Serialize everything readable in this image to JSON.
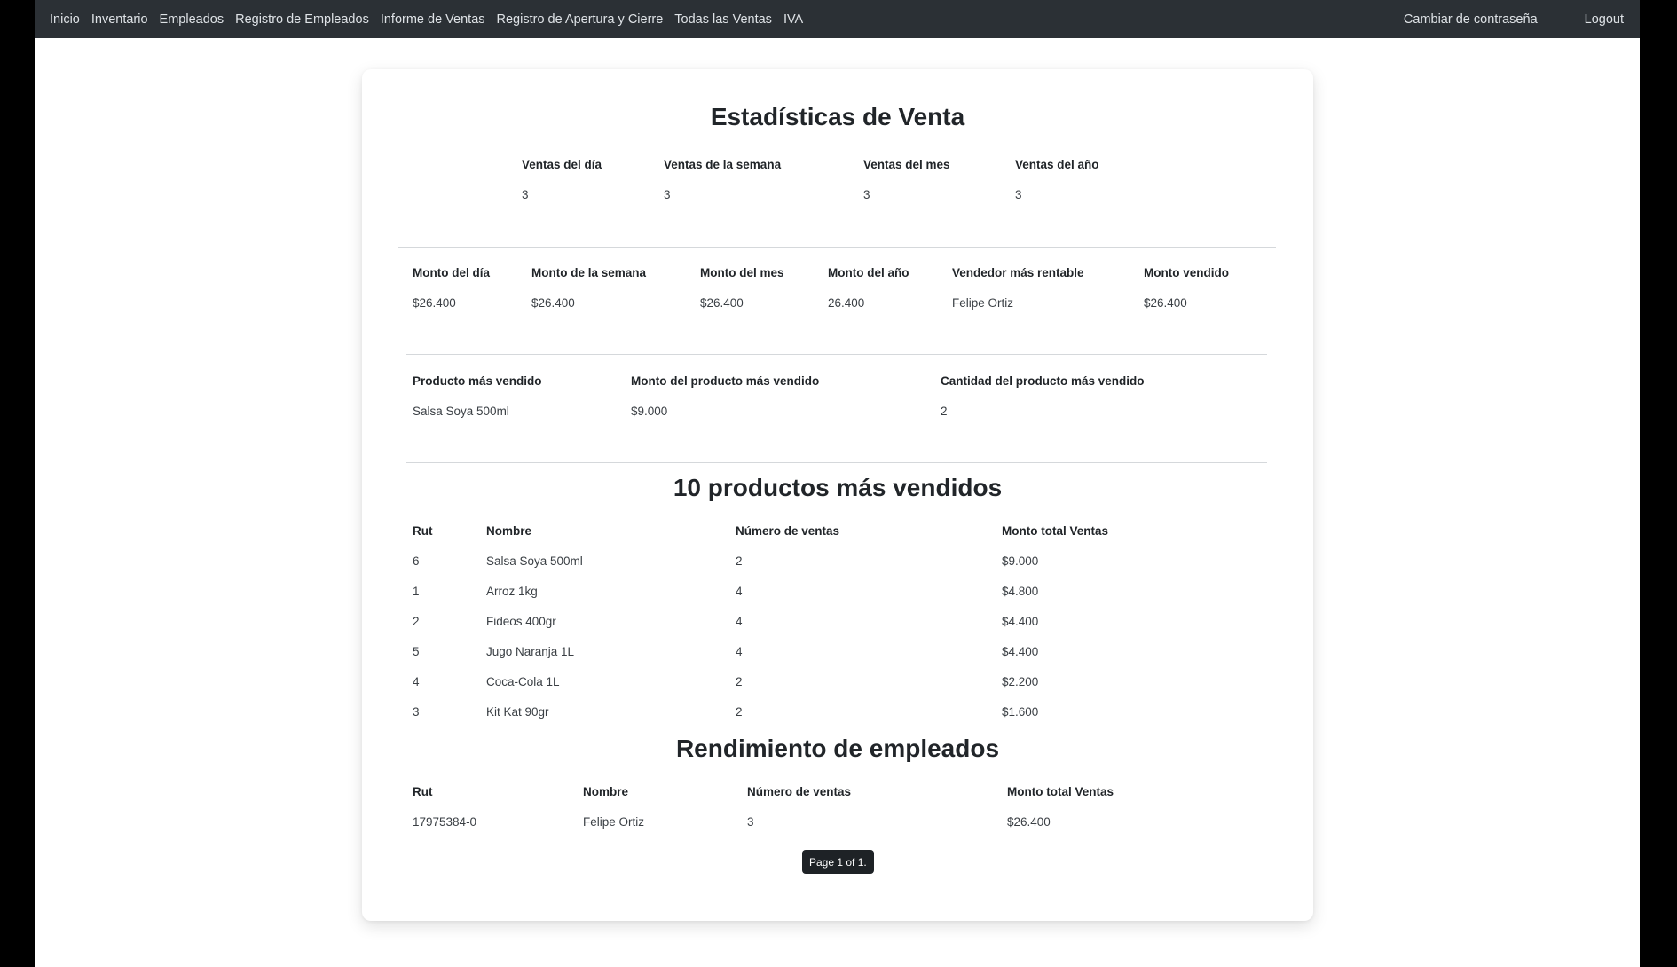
{
  "nav": {
    "links": [
      "Inicio",
      "Inventario",
      "Empleados",
      "Registro de Empleados",
      "Informe de Ventas",
      "Registro de Apertura y Cierre",
      "Todas las Ventas",
      "IVA"
    ],
    "change_password": "Cambiar de contraseña",
    "logout": "Logout"
  },
  "stats": {
    "title": "Estadísticas de Venta",
    "counts": [
      {
        "label": "Ventas del día",
        "value": "3"
      },
      {
        "label": "Ventas de la semana",
        "value": "3"
      },
      {
        "label": "Ventas del mes",
        "value": "3"
      },
      {
        "label": "Ventas del año",
        "value": "3"
      }
    ],
    "amounts": [
      {
        "label": "Monto del día",
        "value": "$26.400"
      },
      {
        "label": "Monto de la semana",
        "value": "$26.400"
      },
      {
        "label": "Monto del mes",
        "value": "$26.400"
      },
      {
        "label": "Monto del año",
        "value": "26.400"
      },
      {
        "label": "Vendedor más rentable",
        "value": "Felipe Ortiz"
      },
      {
        "label": "Monto vendido",
        "value": "$26.400"
      }
    ],
    "top_product": [
      {
        "label": "Producto más vendido",
        "value": "Salsa Soya 500ml"
      },
      {
        "label": "Monto del producto más vendido",
        "value": "$9.000"
      },
      {
        "label": "Cantidad del producto más vendido",
        "value": "2"
      }
    ]
  },
  "top_products": {
    "title": "10 productos más vendidos",
    "headers": [
      "Rut",
      "Nombre",
      "Número de ventas",
      "Monto total Ventas"
    ],
    "rows": [
      [
        "6",
        "Salsa Soya 500ml",
        "2",
        "$9.000"
      ],
      [
        "1",
        "Arroz 1kg",
        "4",
        "$4.800"
      ],
      [
        "2",
        "Fideos 400gr",
        "4",
        "$4.400"
      ],
      [
        "5",
        "Jugo Naranja 1L",
        "4",
        "$4.400"
      ],
      [
        "4",
        "Coca-Cola 1L",
        "2",
        "$2.200"
      ],
      [
        "3",
        "Kit Kat 90gr",
        "2",
        "$1.600"
      ]
    ]
  },
  "employees": {
    "title": "Rendimiento de empleados",
    "headers": [
      "Rut",
      "Nombre",
      "Número de ventas",
      "Monto total Ventas"
    ],
    "rows": [
      [
        "17975384-0",
        "Felipe Ortiz",
        "3",
        "$26.400"
      ]
    ]
  },
  "pager": "Page 1 of 1."
}
